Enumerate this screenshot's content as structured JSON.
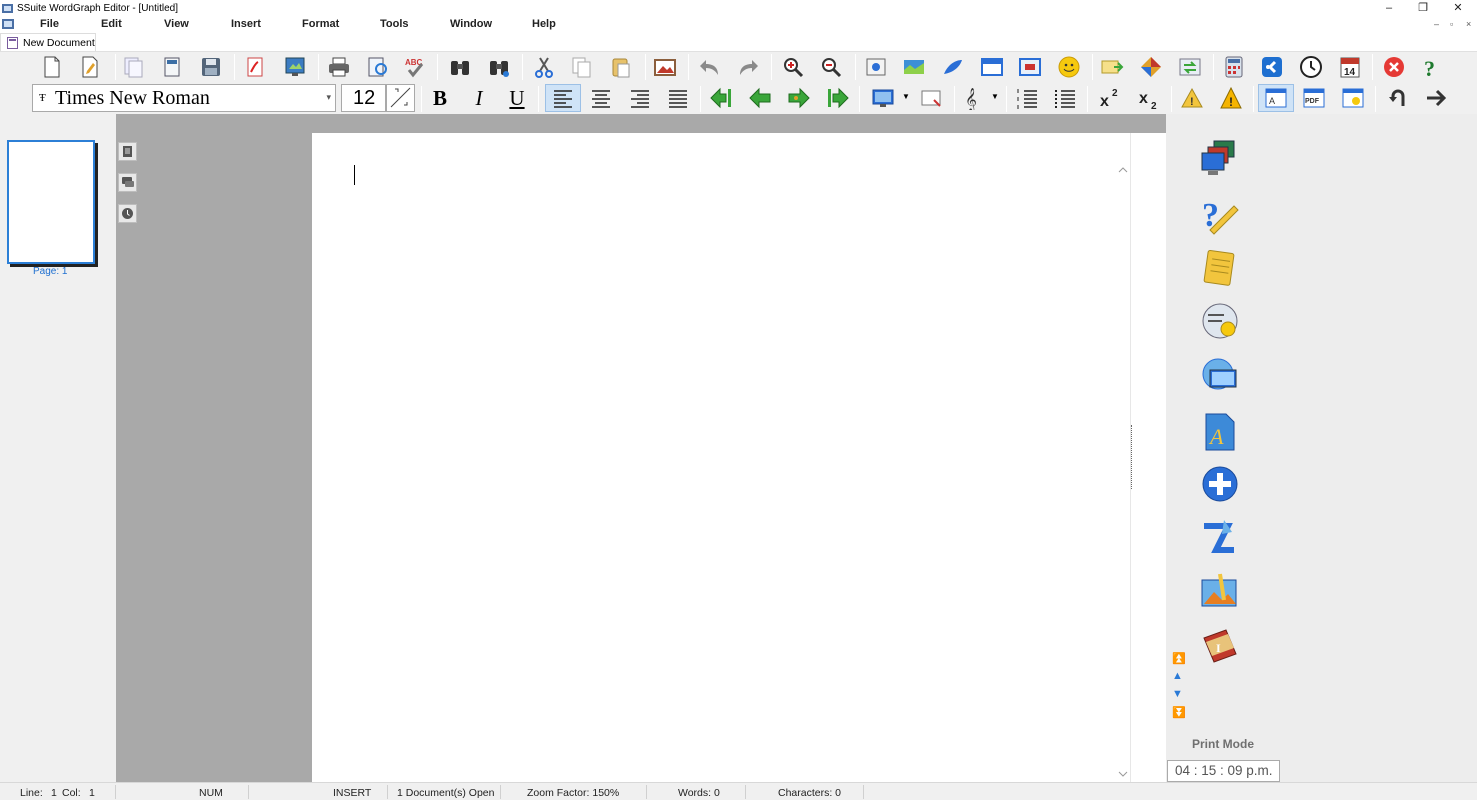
{
  "window": {
    "title": "SSuite WordGraph Editor - [Untitled]",
    "minimize": "–",
    "maximize": "❐",
    "close": "✕"
  },
  "menu": {
    "items": [
      "File",
      "Edit",
      "View",
      "Insert",
      "Format",
      "Tools",
      "Window",
      "Help"
    ],
    "mdi_controls": [
      "–",
      "▫",
      "×"
    ]
  },
  "doc_tab": {
    "label": "New Document"
  },
  "font": {
    "name": "Times New Roman",
    "size": "12"
  },
  "format_buttons": {
    "bold": "B",
    "italic": "I",
    "underline": "U"
  },
  "thumbnail": {
    "label": "Page: 1"
  },
  "side_panel": {
    "mode_label": "Print Mode",
    "clock": "04 : 15 : 09 p.m."
  },
  "status": {
    "line_label": "Line:",
    "line_value": "1",
    "col_label": "Col:",
    "col_value": "1",
    "num": "NUM",
    "mode": "INSERT",
    "docs_open": "1 Document(s) Open",
    "zoom": "Zoom Factor: 150%",
    "words": "Words: 0",
    "characters": "Characters: 0"
  },
  "calendar_day": "14",
  "colors": {
    "accent_blue": "#2c7fd6",
    "workspace_gray": "#a9a9a9",
    "close_red": "#e53935",
    "help_green": "#1f7a2e",
    "arrow_green": "#3aa63a"
  }
}
